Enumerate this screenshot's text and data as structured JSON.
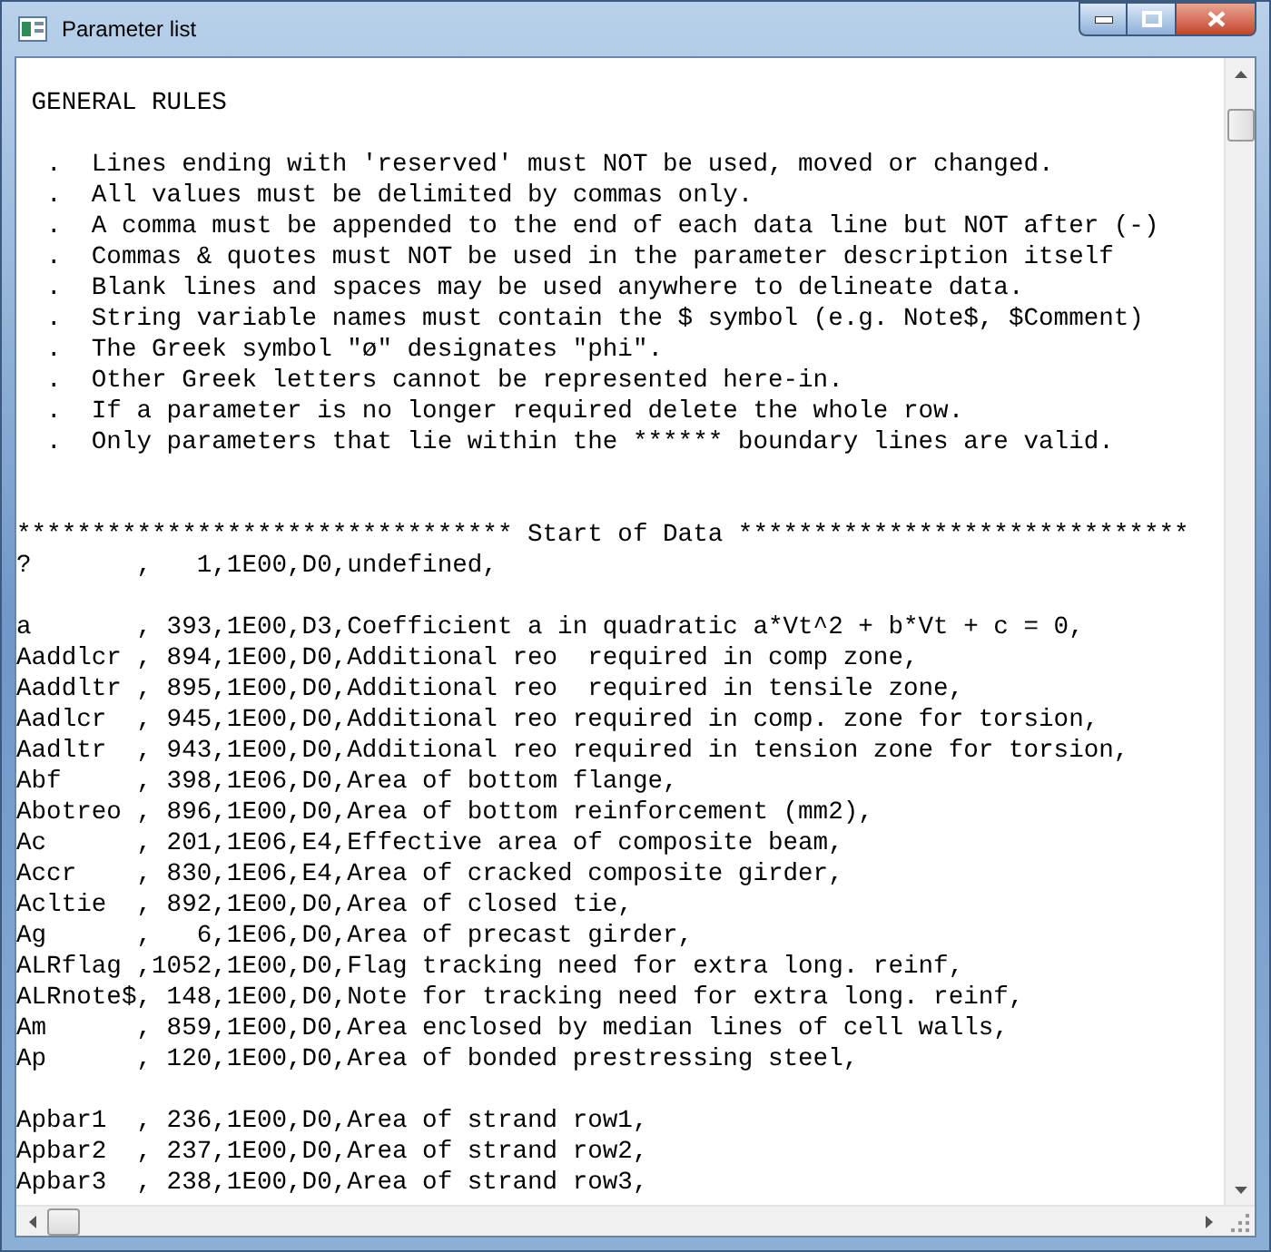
{
  "window": {
    "title": "Parameter list"
  },
  "blocks": [
    {
      "kind": "heading",
      "lines": [
        " GENERAL RULES"
      ]
    },
    {
      "kind": "list",
      "lines": [
        "  .  Lines ending with 'reserved' must NOT be used, moved or changed.",
        "  .  All values must be delimited by commas only.",
        "  .  A comma must be appended to the end of each data line but NOT after (-)",
        "  .  Commas & quotes must NOT be used in the parameter description itself",
        "  .  Blank lines and spaces may be used anywhere to delineate data.",
        "  .  String variable names must contain the $ symbol (e.g. Note$, $Comment)",
        "  .  The Greek symbol \"ø\" designates \"phi\".",
        "  .  Other Greek letters cannot be represented here-in.",
        "  .  If a parameter is no longer required delete the whole row.",
        "  .  Only parameters that lie within the ****** boundary lines are valid."
      ]
    },
    {
      "kind": "section_start",
      "lines": [
        "********************************* Start of Data ******************************",
        "?       ,   1,1E00,D0,undefined,"
      ]
    },
    {
      "kind": "data",
      "lines": [
        "a       , 393,1E00,D3,Coefficient a in quadratic a*Vt^2 + b*Vt + c = 0,",
        "Aaddlcr , 894,1E00,D0,Additional reo  required in comp zone,",
        "Aaddltr , 895,1E00,D0,Additional reo  required in tensile zone,",
        "Aadlcr  , 945,1E00,D0,Additional reo required in comp. zone for torsion,",
        "Aadltr  , 943,1E00,D0,Additional reo required in tension zone for torsion,",
        "Abf     , 398,1E06,D0,Area of bottom flange,",
        "Abotreo , 896,1E00,D0,Area of bottom reinforcement (mm2),",
        "Ac      , 201,1E06,E4,Effective area of composite beam,",
        "Accr    , 830,1E06,E4,Area of cracked composite girder,",
        "Acltie  , 892,1E00,D0,Area of closed tie,",
        "Ag      ,   6,1E06,D0,Area of precast girder,",
        "ALRflag ,1052,1E00,D0,Flag tracking need for extra long. reinf,",
        "ALRnote$, 148,1E00,D0,Note for tracking need for extra long. reinf,",
        "Am      , 859,1E00,D0,Area enclosed by median lines of cell walls,",
        "Ap      , 120,1E00,D0,Area of bonded prestressing steel,"
      ]
    },
    {
      "kind": "data",
      "lines": [
        "Apbar1  , 236,1E00,D0,Area of strand row1,",
        "Apbar2  , 237,1E00,D0,Area of strand row2,",
        "Apbar3  , 238,1E00,D0,Area of strand row3,"
      ]
    }
  ]
}
